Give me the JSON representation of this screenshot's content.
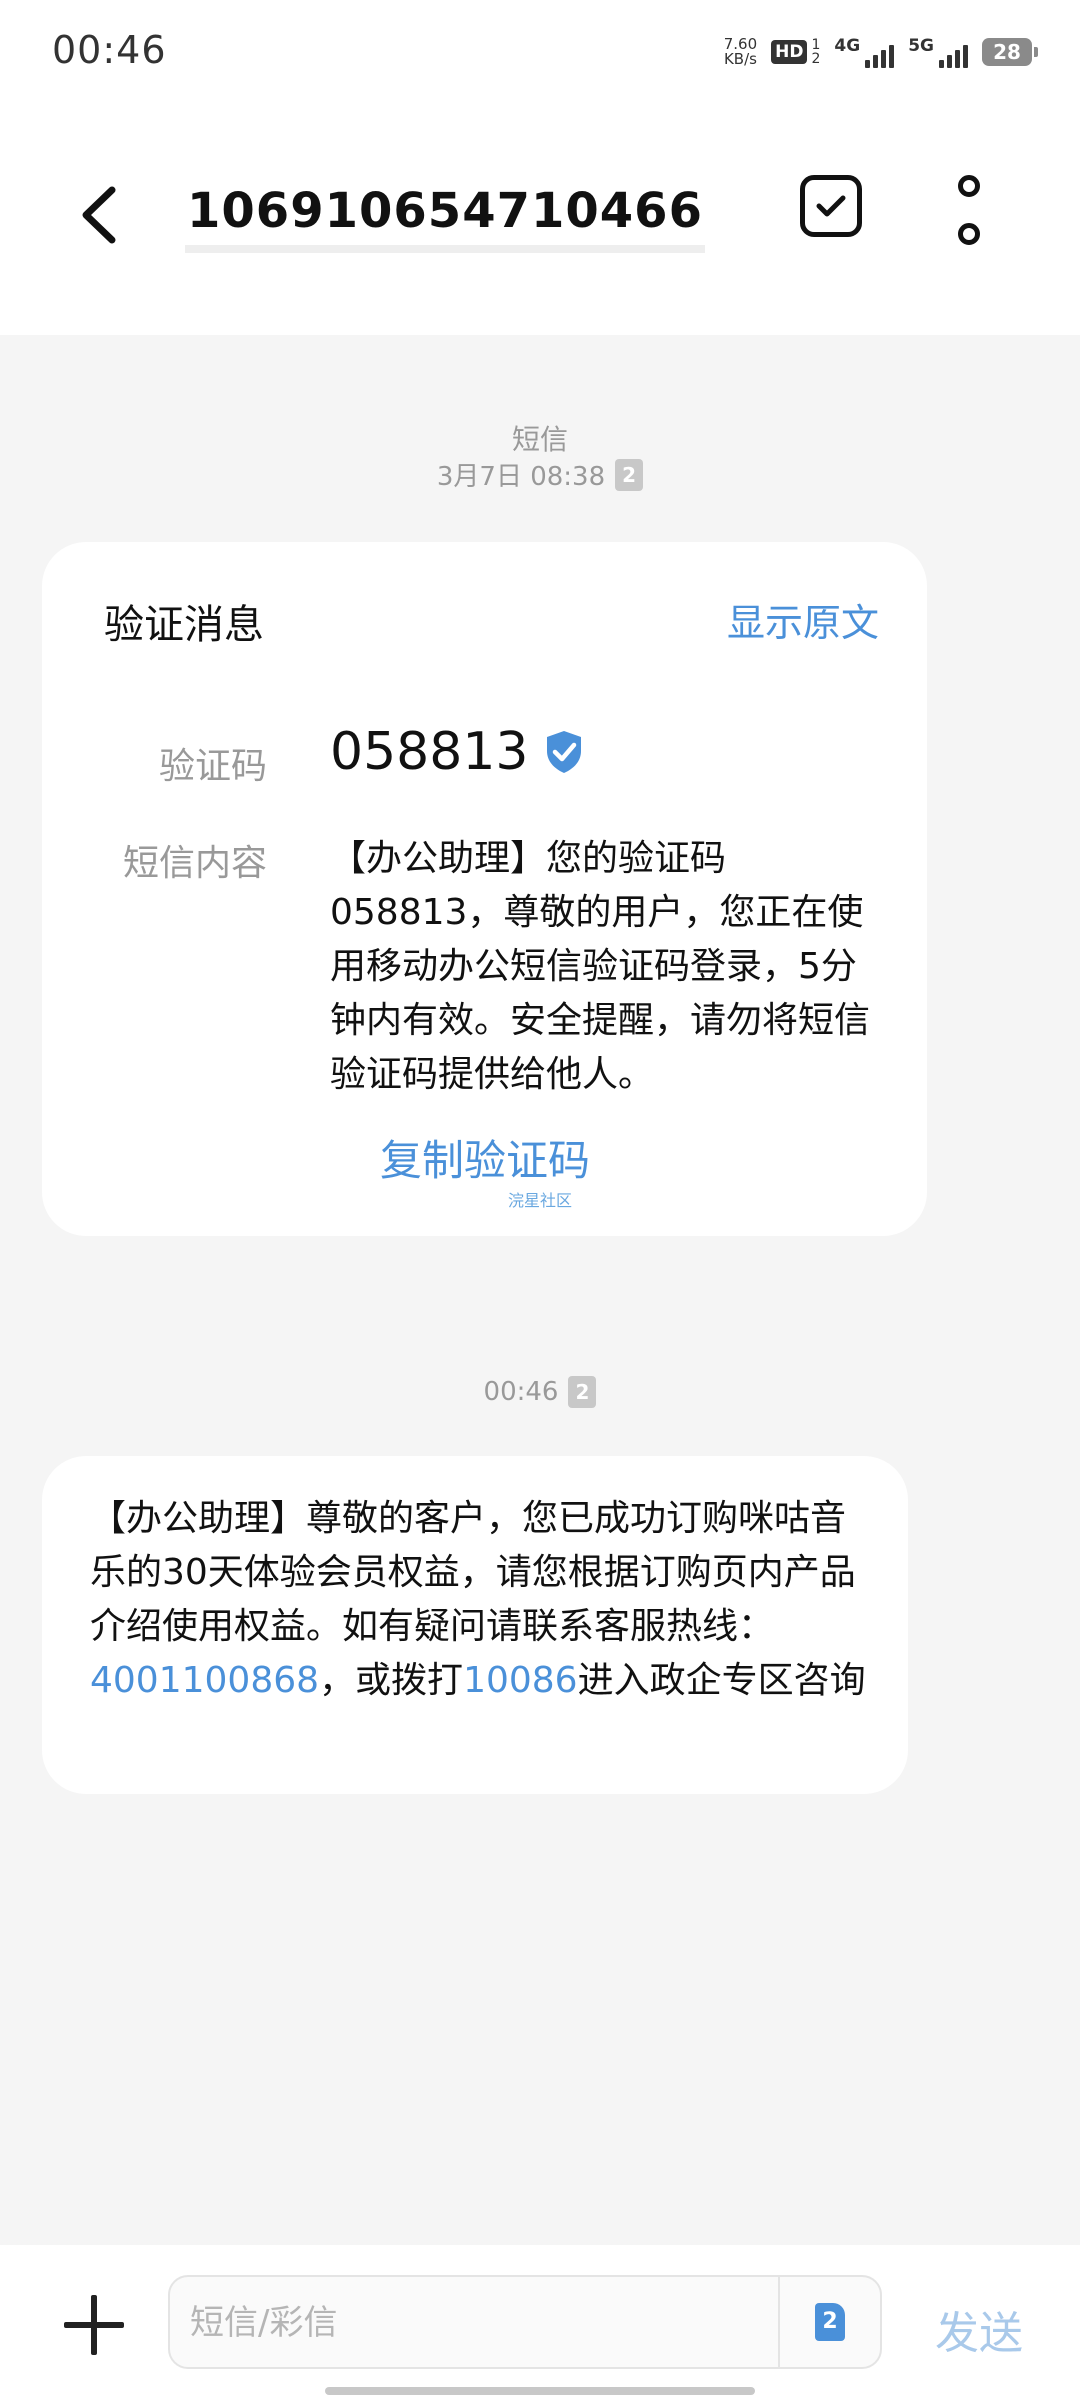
{
  "status_bar": {
    "time": "00:46",
    "net_speed_value": "7.60",
    "net_speed_unit": "KB/s",
    "hd_label": "HD",
    "hd_sub_top": "1",
    "hd_sub_bottom": "2",
    "sig1_label": "4G",
    "sig2_label": "5G",
    "battery": "28"
  },
  "header": {
    "title": "106910654710466"
  },
  "thread": {
    "meta_type": "短信",
    "first_timestamp": "3月7日 08:38",
    "first_sim": "2",
    "second_timestamp": "00:46",
    "second_sim": "2"
  },
  "verify_card": {
    "title": "验证消息",
    "show_original": "显示原文",
    "code_label": "验证码",
    "code": "058813",
    "content_label": "短信内容",
    "content": "【办公助理】您的验证码058813，尊敬的用户，您正在使用移动办公短信验证码登录，5分钟内有效。安全提醒，请勿将短信验证码提供给他人。",
    "copy_label": "复制验证码",
    "watermark": "浣星社区"
  },
  "message2": {
    "part1": "【办公助理】尊敬的客户，您已成功订购咪咕音乐的30天体验会员权益，请您根据订购页内产品介绍使用权益。如有疑问请联系客服热线：",
    "link1": "4001100868",
    "part2": "，或拨打",
    "link2": "10086",
    "part3": "进入政企专区咨询"
  },
  "composer": {
    "placeholder": "短信/彩信",
    "sim_label": "2",
    "send_label": "发送"
  },
  "colors": {
    "accent": "#4a90d9",
    "send_disabled": "#a9c9ea",
    "background": "#f5f5f5"
  }
}
